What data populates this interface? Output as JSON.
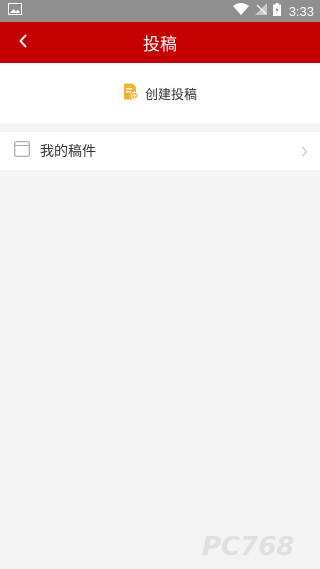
{
  "status_bar": {
    "time": "3:33",
    "icons": [
      "image-icon",
      "wifi-icon",
      "no-sim-icon",
      "battery-icon"
    ]
  },
  "header": {
    "back_icon": "chevron-left-icon",
    "title": "投稿",
    "background_color": "#c40000"
  },
  "create": {
    "icon": "document-add-icon",
    "label": "创建投稿",
    "icon_color": "#f0b430"
  },
  "list": {
    "items": [
      {
        "icon": "draft-box-icon",
        "label": "我的稿件",
        "chevron": "chevron-right-icon"
      }
    ]
  },
  "watermark": {
    "text": "PC768"
  }
}
